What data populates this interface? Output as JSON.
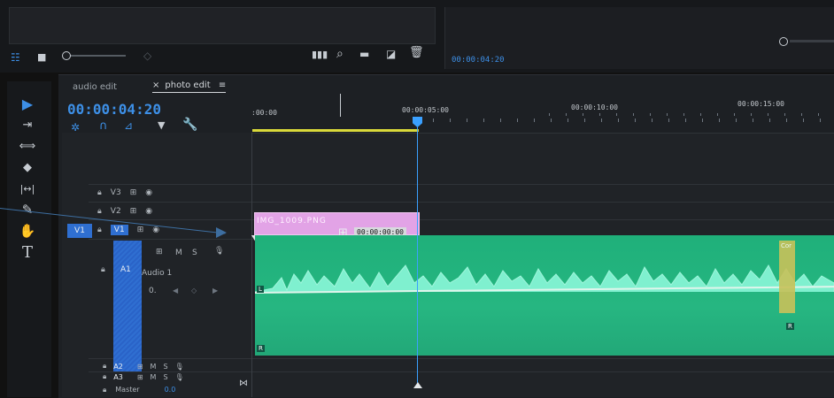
{
  "top_timecode": "00:00:04:20",
  "tabs": [
    {
      "label": "audio edit"
    },
    {
      "label": "photo edit",
      "close": "×",
      "menu": "≡"
    }
  ],
  "sequence": {
    "current_timecode": "00:00:04:20"
  },
  "ruler": {
    "labels": [
      ":00:00",
      "00:00:05:00",
      "00:00:10:00",
      "00:00:15:00"
    ]
  },
  "tracks": {
    "video": [
      {
        "name": "V3"
      },
      {
        "name": "V2"
      },
      {
        "name": "V1",
        "source_patch": "V1"
      }
    ],
    "audio": [
      {
        "name": "A1",
        "label": "Audio 1",
        "volume": "0."
      },
      {
        "name": "A2"
      },
      {
        "name": "A3"
      }
    ],
    "master": {
      "label": "Master",
      "value": "0.0"
    },
    "mute": "M",
    "solo": "S"
  },
  "clip": {
    "name": "IMG_1009.PNG",
    "drag_timecode": "00:00:00:00"
  },
  "audio_clip_label": "Cor",
  "channel_left": "L",
  "channel_right": "R",
  "tools": [
    {
      "icon": "selection-tool-icon",
      "glyph": "▶"
    },
    {
      "icon": "track-select-tool-icon",
      "glyph": "⇥"
    },
    {
      "icon": "ripple-edit-tool-icon",
      "glyph": "⟺"
    },
    {
      "icon": "razor-tool-icon",
      "glyph": "◆"
    },
    {
      "icon": "slip-tool-icon",
      "glyph": "|↔|"
    },
    {
      "icon": "pen-tool-icon",
      "glyph": "✎"
    },
    {
      "icon": "hand-tool-icon",
      "glyph": "✋"
    },
    {
      "icon": "type-tool-icon",
      "glyph": "T"
    }
  ],
  "colors": {
    "accent_blue": "#3d8fe6",
    "clip_pink": "#e2a3e6",
    "audio_green": "#27b07d",
    "audio_wave": "#7ff0cf",
    "playhead": "#3aa0ff",
    "work_area_yellow": "#d9d93a",
    "adjustment_yellow": "#c8c25a"
  }
}
